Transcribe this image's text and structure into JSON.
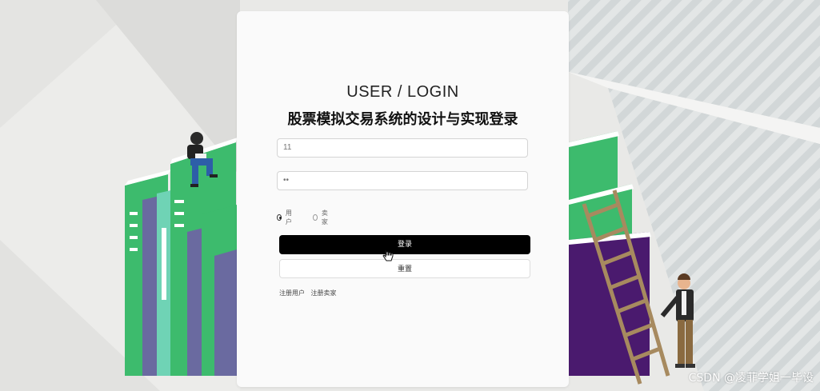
{
  "login": {
    "title_en": "USER / LOGIN",
    "title_cn": "股票模拟交易系统的设计与实现登录",
    "username_value": "11",
    "password_value": "••",
    "roles": [
      {
        "label": "用户",
        "selected": true
      },
      {
        "label": "卖家",
        "selected": false
      }
    ],
    "login_button": "登录",
    "reset_button": "重置",
    "links": [
      "注册用户",
      "注册卖家"
    ]
  },
  "watermark": "CSDN @凌菲学姐一毕设",
  "colors": {
    "primary_button": "#000000",
    "book_green": "#3dbb6d",
    "book_purple": "#6a6aa0",
    "book_teal": "#6fd3b5",
    "ladder": "#a78a5f"
  }
}
